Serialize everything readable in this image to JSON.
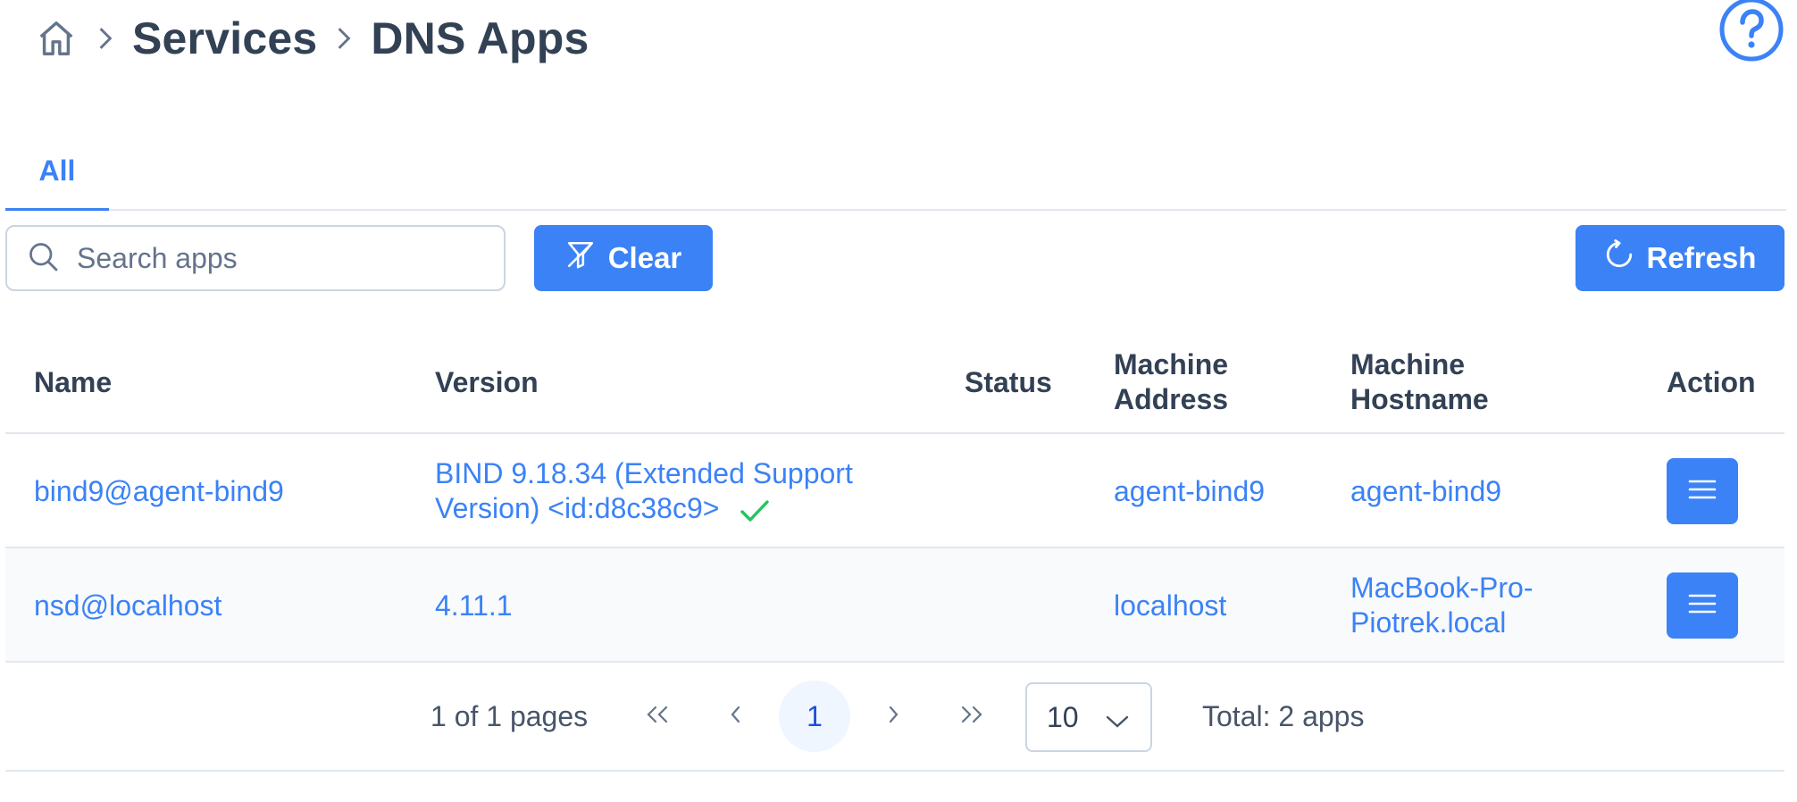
{
  "breadcrumb": {
    "home_icon": "home-icon",
    "items": [
      "Services",
      "DNS Apps"
    ]
  },
  "help_icon": "question-circle-icon",
  "tabs": [
    {
      "label": "All",
      "active": true
    }
  ],
  "toolbar": {
    "search_placeholder": "Search apps",
    "search_value": "",
    "clear_label": "Clear",
    "clear_icon": "filter-slash-icon",
    "refresh_label": "Refresh",
    "refresh_icon": "refresh-icon"
  },
  "table": {
    "columns": [
      "Name",
      "Version",
      "Status",
      "Machine Address",
      "Machine Hostname",
      "Action"
    ],
    "rows": [
      {
        "name": "bind9@agent-bind9",
        "version": "BIND 9.18.34 (Extended Support Version) <id:d8c38c9>",
        "version_status_icon": "check-icon",
        "status": "",
        "machine_address": "agent-bind9",
        "machine_hostname": "agent-bind9",
        "action_icon": "menu-bars-icon"
      },
      {
        "name": "nsd@localhost",
        "version": "4.11.1",
        "status": "",
        "machine_address": "localhost",
        "machine_hostname": "MacBook-Pro-Piotrek.local",
        "action_icon": "menu-bars-icon"
      }
    ]
  },
  "paginator": {
    "page_report": "1 of 1 pages",
    "current_page": "1",
    "rows_per_page": "10",
    "total": "Total: 2 apps"
  },
  "colors": {
    "accent": "#3b82f6",
    "text": "#334155",
    "success": "#22c55e",
    "border": "#e2e8f0"
  }
}
